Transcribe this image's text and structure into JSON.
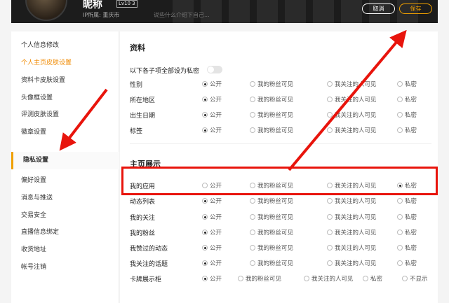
{
  "header": {
    "nickname": "昵称",
    "level": "Lv10 3",
    "ip_location": "IP所属: 重庆市",
    "bio_placeholder": "说些什么介绍下自己...",
    "cancel_label": "取消",
    "save_label": "保存"
  },
  "sidebar": {
    "items": [
      {
        "label": "个人信息修改"
      },
      {
        "label": "个人主页皮肤设置"
      },
      {
        "label": "资料卡皮肤设置"
      },
      {
        "label": "头像框设置"
      },
      {
        "label": "评测皮肤设置"
      },
      {
        "label": "徽章设置"
      },
      {
        "label": "隐私设置"
      },
      {
        "label": "偏好设置"
      },
      {
        "label": "消息与推送"
      },
      {
        "label": "交易安全"
      },
      {
        "label": "直播信息绑定"
      },
      {
        "label": "收货地址"
      },
      {
        "label": "帐号注销"
      }
    ]
  },
  "profile_section": {
    "title": "资料",
    "all_private_label": "以下各子项全部设为私密",
    "rows": [
      {
        "label": "性别",
        "options": [
          "公开",
          "我的粉丝可见",
          "我关注的人可见",
          "私密"
        ],
        "selected": 0
      },
      {
        "label": "所在地区",
        "options": [
          "公开",
          "我的粉丝可见",
          "我关注的人可见",
          "私密"
        ],
        "selected": 0
      },
      {
        "label": "出生日期",
        "options": [
          "公开",
          "我的粉丝可见",
          "我关注的人可见",
          "私密"
        ],
        "selected": 0
      },
      {
        "label": "标签",
        "options": [
          "公开",
          "我的粉丝可见",
          "我关注的人可见",
          "私密"
        ],
        "selected": 0
      }
    ]
  },
  "homepage_section": {
    "title": "主页展示",
    "rows": [
      {
        "label": "我的应用",
        "options": [
          "公开",
          "我的粉丝可见",
          "我关注的人可见",
          "私密"
        ],
        "selected": 3
      },
      {
        "label": "动态列表",
        "options": [
          "公开",
          "我的粉丝可见",
          "我关注的人可见",
          "私密"
        ],
        "selected": 0
      },
      {
        "label": "我的关注",
        "options": [
          "公开",
          "我的粉丝可见",
          "我关注的人可见",
          "私密"
        ],
        "selected": 0
      },
      {
        "label": "我的粉丝",
        "options": [
          "公开",
          "我的粉丝可见",
          "我关注的人可见",
          "私密"
        ],
        "selected": 0
      },
      {
        "label": "我赞过的动态",
        "options": [
          "公开",
          "我的粉丝可见",
          "我关注的人可见",
          "私密"
        ],
        "selected": 0
      },
      {
        "label": "我关注的话题",
        "options": [
          "公开",
          "我的粉丝可见",
          "我关注的人可见",
          "私密"
        ],
        "selected": 0
      },
      {
        "label": "卡牌展示柜",
        "options": [
          "公开",
          "我的粉丝可见",
          "我关注的人可见",
          "私密",
          "不显示"
        ],
        "selected": 0
      }
    ]
  },
  "colors": {
    "accent": "#f0a000",
    "annotation_red": "#e8140c",
    "header_bg": "#1c1c1c"
  }
}
